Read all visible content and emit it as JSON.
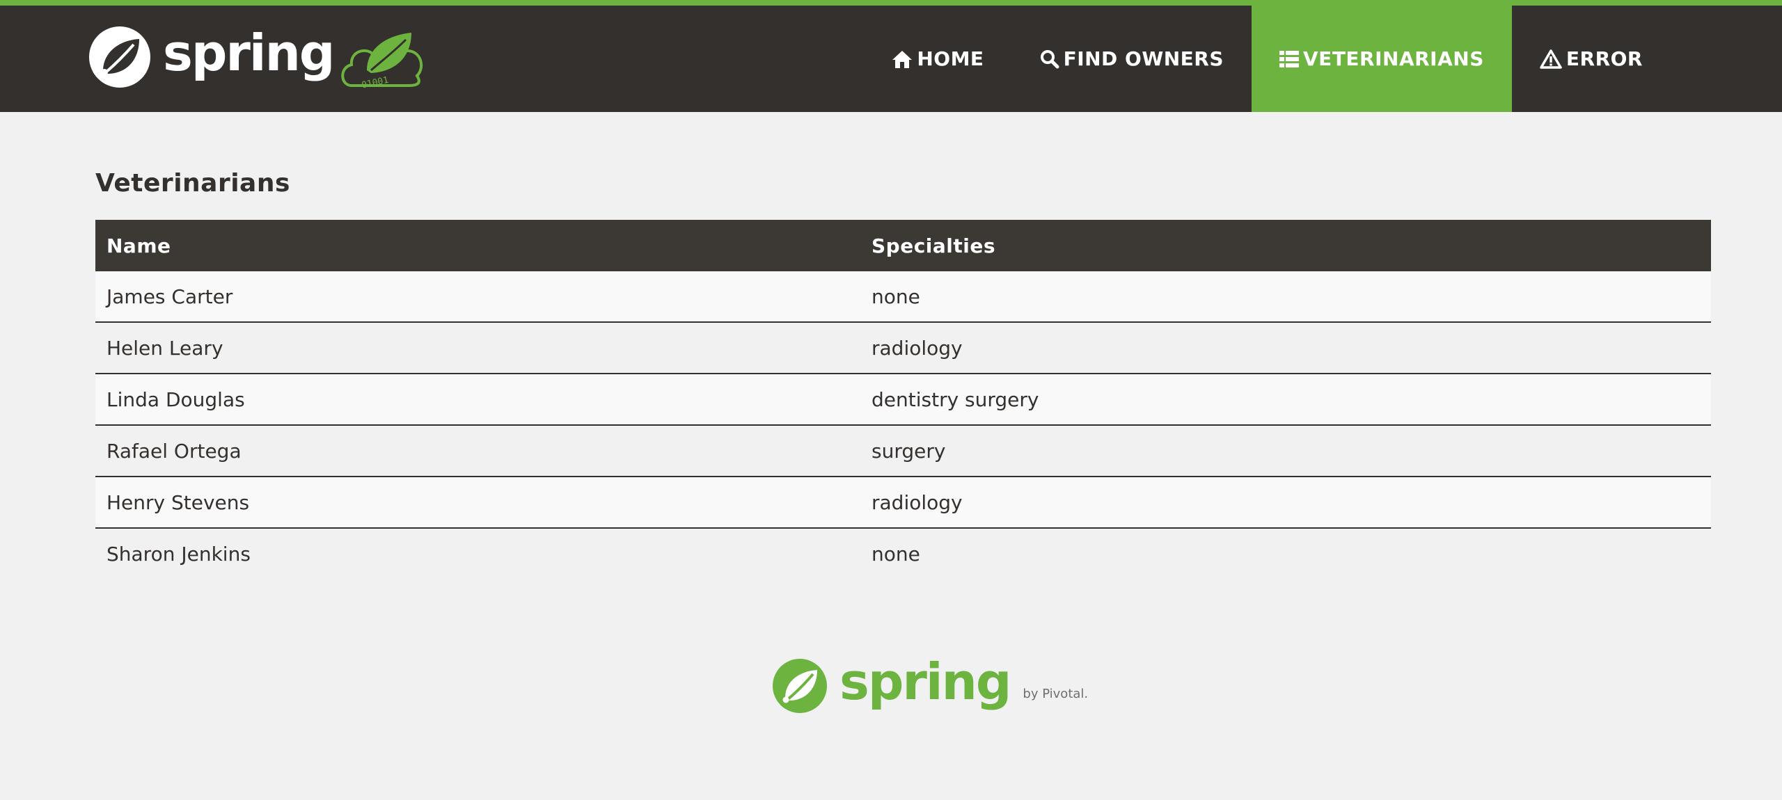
{
  "header": {
    "logo_text": "spring",
    "logo_cloud_digits": "01001",
    "accent_color": "#6db33f",
    "nav": [
      {
        "label": "HOME",
        "icon": "home-icon",
        "active": false
      },
      {
        "label": "FIND OWNERS",
        "icon": "search-icon",
        "active": false
      },
      {
        "label": "VETERINARIANS",
        "icon": "list-icon",
        "active": true
      },
      {
        "label": "ERROR",
        "icon": "warning-icon",
        "active": false
      }
    ]
  },
  "main": {
    "title": "Veterinarians",
    "table": {
      "columns": [
        "Name",
        "Specialties"
      ],
      "rows": [
        {
          "name": "James Carter",
          "specialties": "none"
        },
        {
          "name": "Helen Leary",
          "specialties": "radiology"
        },
        {
          "name": "Linda Douglas",
          "specialties": "dentistry surgery"
        },
        {
          "name": "Rafael Ortega",
          "specialties": "surgery"
        },
        {
          "name": "Henry Stevens",
          "specialties": "radiology"
        },
        {
          "name": "Sharon Jenkins",
          "specialties": "none"
        }
      ]
    }
  },
  "footer": {
    "logo_text": "spring",
    "by_text": "by Pivotal."
  }
}
